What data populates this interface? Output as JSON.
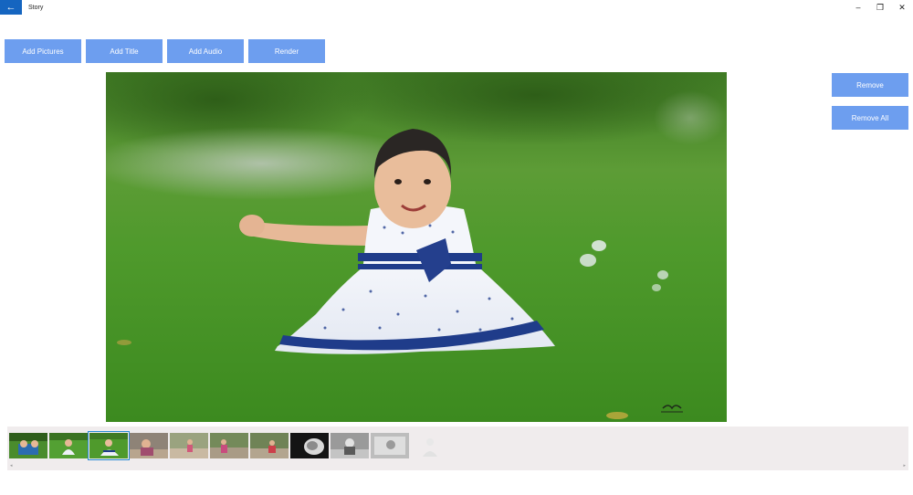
{
  "window": {
    "title": "Story",
    "back_glyph": "←",
    "minimize_glyph": "–",
    "restore_glyph": "❐",
    "close_glyph": "✕"
  },
  "toolbar": {
    "add_pictures": "Add Pictures",
    "add_title": "Add Title",
    "add_audio": "Add Audio",
    "render": "Render"
  },
  "side_actions": {
    "remove": "Remove",
    "remove_all": "Remove All"
  },
  "filmstrip": {
    "selected_index": 2,
    "thumb_count": 11,
    "scroll_left_glyph": "◂",
    "scroll_right_glyph": "▸"
  },
  "colors": {
    "accent_button": "#6d9eef",
    "back_button": "#1565c0",
    "selection_outline": "#2a8ad4",
    "filmstrip_bg": "#f0eced"
  },
  "icons": [
    "back-arrow-icon",
    "minimize-icon",
    "restore-icon",
    "close-icon"
  ]
}
